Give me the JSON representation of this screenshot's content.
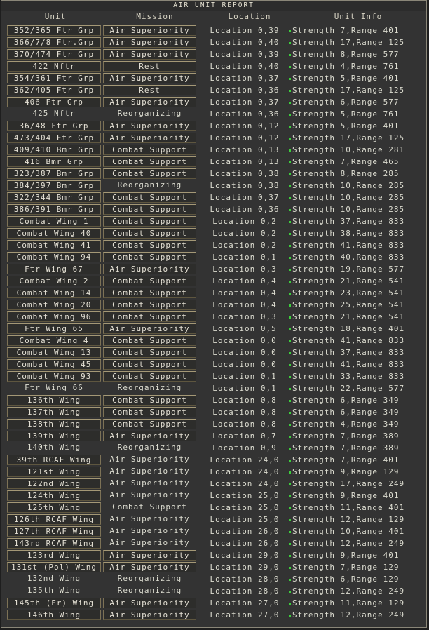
{
  "window": {
    "title": "AIR UNIT REPORT"
  },
  "columns": {
    "unit": "Unit",
    "mission": "Mission",
    "location": "Location",
    "info": "Unit Info"
  },
  "colors": {
    "status_dot": "#3ccf3c",
    "frame": "#8a8678",
    "button_border": "#7d7256",
    "background": "#333333"
  },
  "icons": {
    "status": "green-status-dot-icon"
  },
  "rows": [
    {
      "unit": "352/365 Ftr Grp",
      "mission": "Air Superiority",
      "location": "Location 0,39",
      "strength": "Strength 7",
      "range": "Range 401",
      "unit_boxed": true,
      "mission_boxed": true
    },
    {
      "unit": "366/7/8 Ftr.Grp",
      "mission": "Air Superiority",
      "location": "Location 0,40",
      "strength": "Strength 17",
      "range": "Range 125",
      "unit_boxed": true,
      "mission_boxed": true
    },
    {
      "unit": "370/474 Ftr Grp",
      "mission": "Air Superiority",
      "location": "Location 0,39",
      "strength": "Strength 8",
      "range": "Range 577",
      "unit_boxed": true,
      "mission_boxed": true
    },
    {
      "unit": "422 Nftr",
      "mission": "Rest",
      "location": "Location 0,40",
      "strength": "Strength 4",
      "range": "Range 761",
      "unit_boxed": true,
      "mission_boxed": true
    },
    {
      "unit": "354/361 Ftr Grp",
      "mission": "Air Superiority",
      "location": "Location 0,37",
      "strength": "Strength 5",
      "range": "Range 401",
      "unit_boxed": true,
      "mission_boxed": true
    },
    {
      "unit": "362/405 Ftr Grp",
      "mission": "Rest",
      "location": "Location 0,36",
      "strength": "Strength 17",
      "range": "Range 125",
      "unit_boxed": true,
      "mission_boxed": true
    },
    {
      "unit": "406 Ftr Grp",
      "mission": "Air Superiority",
      "location": "Location 0,37",
      "strength": "Strength 6",
      "range": "Range 577",
      "unit_boxed": true,
      "mission_boxed": true
    },
    {
      "unit": "425 Nftr",
      "mission": "Reorganizing",
      "location": "Location 0,36",
      "strength": "Strength 5",
      "range": "Range 761",
      "unit_boxed": false,
      "mission_boxed": false
    },
    {
      "unit": "36/48 Ftr Grp",
      "mission": "Air Superiority",
      "location": "Location 0,12",
      "strength": "Strength 5",
      "range": "Range 401",
      "unit_boxed": true,
      "mission_boxed": true
    },
    {
      "unit": "473/404 Ftr Grp",
      "mission": "Air Superiority",
      "location": "Location 0,12",
      "strength": "Strength 17",
      "range": "Range 125",
      "unit_boxed": true,
      "mission_boxed": true
    },
    {
      "unit": "409/410 Bmr Grp",
      "mission": "Combat Support",
      "location": "Location 0,13",
      "strength": "Strength 10",
      "range": "Range 281",
      "unit_boxed": true,
      "mission_boxed": true
    },
    {
      "unit": "416 Bmr Grp",
      "mission": "Combat Support",
      "location": "Location 0,13",
      "strength": "Strength 7",
      "range": "Range 465",
      "unit_boxed": true,
      "mission_boxed": true
    },
    {
      "unit": "323/387 Bmr Grp",
      "mission": "Combat Support",
      "location": "Location 0,38",
      "strength": "Strength 8",
      "range": "Range 285",
      "unit_boxed": true,
      "mission_boxed": true
    },
    {
      "unit": "384/397 Bmr Grp",
      "mission": "Reorganizing",
      "location": "Location 0,38",
      "strength": "Strength 10",
      "range": "Range 285",
      "unit_boxed": true,
      "mission_boxed": false
    },
    {
      "unit": "322/344 Bmr Grp",
      "mission": "Combat Support",
      "location": "Location 0,37",
      "strength": "Strength 10",
      "range": "Range 285",
      "unit_boxed": true,
      "mission_boxed": true
    },
    {
      "unit": "386/391 Bmr Grp",
      "mission": "Combat Support",
      "location": "Location 0,36",
      "strength": "Strength 10",
      "range": "Range 285",
      "unit_boxed": true,
      "mission_boxed": true
    },
    {
      "unit": "Combat Wing 1",
      "mission": "Combat Support",
      "location": "Location 0,2",
      "strength": "Strength 37",
      "range": "Range 833",
      "unit_boxed": true,
      "mission_boxed": true
    },
    {
      "unit": "Combat Wing 40",
      "mission": "Combat Support",
      "location": "Location 0,2",
      "strength": "Strength 38",
      "range": "Range 833",
      "unit_boxed": true,
      "mission_boxed": true
    },
    {
      "unit": "Combat Wing 41",
      "mission": "Combat Support",
      "location": "Location 0,2",
      "strength": "Strength 41",
      "range": "Range 833",
      "unit_boxed": true,
      "mission_boxed": true
    },
    {
      "unit": "Combat Wing 94",
      "mission": "Combat Support",
      "location": "Location 0,1",
      "strength": "Strength 40",
      "range": "Range 833",
      "unit_boxed": true,
      "mission_boxed": true
    },
    {
      "unit": "Ftr Wing 67",
      "mission": "Air Superiority",
      "location": "Location 0,3",
      "strength": "Strength 19",
      "range": "Range 577",
      "unit_boxed": true,
      "mission_boxed": true
    },
    {
      "unit": "Combat Wing 2",
      "mission": "Combat Support",
      "location": "Location 0,4",
      "strength": "Strength 21",
      "range": "Range 541",
      "unit_boxed": true,
      "mission_boxed": true
    },
    {
      "unit": "Combat Wing 14",
      "mission": "Combat Support",
      "location": "Location 0,4",
      "strength": "Strength 23",
      "range": "Range 541",
      "unit_boxed": true,
      "mission_boxed": true
    },
    {
      "unit": "Combat Wing 20",
      "mission": "Combat Support",
      "location": "Location 0,4",
      "strength": "Strength 25",
      "range": "Range 541",
      "unit_boxed": true,
      "mission_boxed": true
    },
    {
      "unit": "Combat Wing 96",
      "mission": "Combat Support",
      "location": "Location 0,3",
      "strength": "Strength 21",
      "range": "Range 541",
      "unit_boxed": true,
      "mission_boxed": true
    },
    {
      "unit": "Ftr Wing 65",
      "mission": "Air Superiority",
      "location": "Location 0,5",
      "strength": "Strength 18",
      "range": "Range 401",
      "unit_boxed": true,
      "mission_boxed": true
    },
    {
      "unit": "Combat Wing 4",
      "mission": "Combat Support",
      "location": "Location 0,0",
      "strength": "Strength 41",
      "range": "Range 833",
      "unit_boxed": true,
      "mission_boxed": true
    },
    {
      "unit": "Combat Wing 13",
      "mission": "Combat Support",
      "location": "Location 0,0",
      "strength": "Strength 37",
      "range": "Range 833",
      "unit_boxed": true,
      "mission_boxed": true
    },
    {
      "unit": "Combat Wing 45",
      "mission": "Combat Support",
      "location": "Location 0,0",
      "strength": "Strength 41",
      "range": "Range 833",
      "unit_boxed": true,
      "mission_boxed": true
    },
    {
      "unit": "Combat Wing 93",
      "mission": "Combat Support",
      "location": "Location 0,1",
      "strength": "Strength 33",
      "range": "Range 833",
      "unit_boxed": true,
      "mission_boxed": true
    },
    {
      "unit": "Ftr Wing 66",
      "mission": "Reorganizing",
      "location": "Location 0,1",
      "strength": "Strength 22",
      "range": "Range 577",
      "unit_boxed": false,
      "mission_boxed": false
    },
    {
      "unit": "136th Wing",
      "mission": "Combat Support",
      "location": "Location 0,8",
      "strength": "Strength 6",
      "range": "Range 349",
      "unit_boxed": true,
      "mission_boxed": true
    },
    {
      "unit": "137th Wing",
      "mission": "Combat Support",
      "location": "Location 0,8",
      "strength": "Strength 6",
      "range": "Range 349",
      "unit_boxed": true,
      "mission_boxed": true
    },
    {
      "unit": "138th Wing",
      "mission": "Combat Support",
      "location": "Location 0,8",
      "strength": "Strength 4",
      "range": "Range 349",
      "unit_boxed": true,
      "mission_boxed": true
    },
    {
      "unit": "139th Wing",
      "mission": "Air Superiority",
      "location": "Location 0,7",
      "strength": "Strength 7",
      "range": "Range 389",
      "unit_boxed": true,
      "mission_boxed": true
    },
    {
      "unit": "140th Wing",
      "mission": "Reorganizing",
      "location": "Location 0,9",
      "strength": "Strength 7",
      "range": "Range 389",
      "unit_boxed": false,
      "mission_boxed": false
    },
    {
      "unit": "39th RCAF Wing",
      "mission": "Air Superiority",
      "location": "Location 24,0",
      "strength": "Strength 7",
      "range": "Range 401",
      "unit_boxed": true,
      "mission_boxed": false
    },
    {
      "unit": "121st Wing",
      "mission": "Air Superiority",
      "location": "Location 24,0",
      "strength": "Strength 9",
      "range": "Range 129",
      "unit_boxed": true,
      "mission_boxed": false
    },
    {
      "unit": "122nd Wing",
      "mission": "Air Superiority",
      "location": "Location 24,0",
      "strength": "Strength 17",
      "range": "Range 249",
      "unit_boxed": true,
      "mission_boxed": false
    },
    {
      "unit": "124th Wing",
      "mission": "Air Superiority",
      "location": "Location 25,0",
      "strength": "Strength 9",
      "range": "Range 401",
      "unit_boxed": true,
      "mission_boxed": false
    },
    {
      "unit": "125th Wing",
      "mission": "Combat Support",
      "location": "Location 25,0",
      "strength": "Strength 11",
      "range": "Range 401",
      "unit_boxed": true,
      "mission_boxed": false
    },
    {
      "unit": "126th RCAF Wing",
      "mission": "Air Superiority",
      "location": "Location 25,0",
      "strength": "Strength 12",
      "range": "Range 129",
      "unit_boxed": true,
      "mission_boxed": false
    },
    {
      "unit": "127th RCAF Wing",
      "mission": "Air Superiority",
      "location": "Location 26,0",
      "strength": "Strength 10",
      "range": "Range 401",
      "unit_boxed": true,
      "mission_boxed": false
    },
    {
      "unit": "143rd RCAF Wing",
      "mission": "Air Superiority",
      "location": "Location 26,0",
      "strength": "Strength 12",
      "range": "Range 249",
      "unit_boxed": true,
      "mission_boxed": false
    },
    {
      "unit": "123rd Wing",
      "mission": "Air Superiority",
      "location": "Location 29,0",
      "strength": "Strength 9",
      "range": "Range 401",
      "unit_boxed": true,
      "mission_boxed": true
    },
    {
      "unit": "131st (Pol) Wing",
      "mission": "Air Superiority",
      "location": "Location 29,0",
      "strength": "Strength 7",
      "range": "Range 129",
      "unit_boxed": true,
      "mission_boxed": true
    },
    {
      "unit": "132nd Wing",
      "mission": "Reorganizing",
      "location": "Location 28,0",
      "strength": "Strength 6",
      "range": "Range 129",
      "unit_boxed": false,
      "mission_boxed": false
    },
    {
      "unit": "135th Wing",
      "mission": "Reorganizing",
      "location": "Location 28,0",
      "strength": "Strength 12",
      "range": "Range 249",
      "unit_boxed": false,
      "mission_boxed": false
    },
    {
      "unit": "145th (Fr) Wing",
      "mission": "Air Superiority",
      "location": "Location 27,0",
      "strength": "Strength 11",
      "range": "Range 129",
      "unit_boxed": true,
      "mission_boxed": true
    },
    {
      "unit": "146th Wing",
      "mission": "Air Superiority",
      "location": "Location 27,0",
      "strength": "Strength 12",
      "range": "Range 249",
      "unit_boxed": true,
      "mission_boxed": true
    }
  ]
}
